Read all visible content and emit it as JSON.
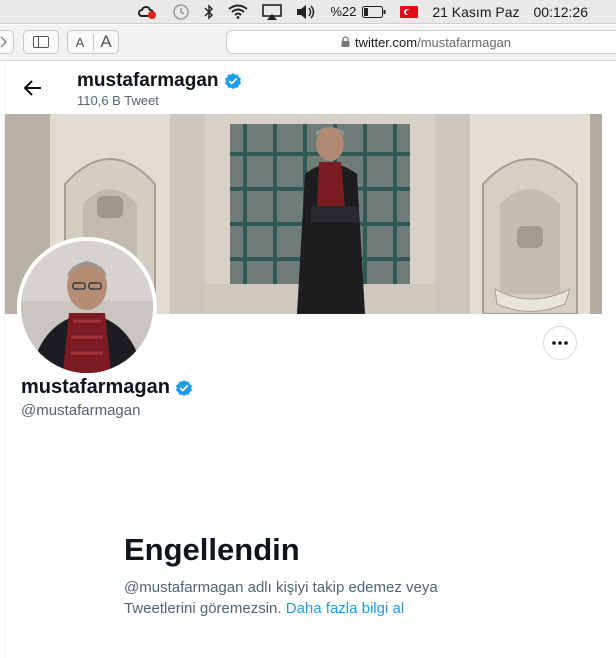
{
  "menubar": {
    "battery_percent": "%22",
    "date": "21 Kasım Paz",
    "time": "00:12:26",
    "icons": [
      "creative-cloud-icon",
      "time-machine-icon",
      "bluetooth-icon",
      "wifi-icon",
      "airplay-icon",
      "volume-icon",
      "battery-icon",
      "turkish-flag-icon"
    ]
  },
  "toolbar": {
    "font_small": "A",
    "font_large": "A",
    "url_host": "twitter.com",
    "url_path": "/mustafarmagan"
  },
  "header": {
    "name": "mustafarmagan",
    "tweet_count": "110,6 B Tweet"
  },
  "profile": {
    "name": "mustafarmagan",
    "handle": "@mustafarmagan",
    "verified": true
  },
  "blocked": {
    "title": "Engellendin",
    "message": "@mustafarmagan adlı kişiyi takip edemez veya Tweetlerini göremezsin.",
    "link": "Daha fazla bilgi al"
  },
  "colors": {
    "link_blue": "#1d9bf0",
    "verified_blue": "#1d9bf0",
    "secondary_text": "#536471"
  }
}
